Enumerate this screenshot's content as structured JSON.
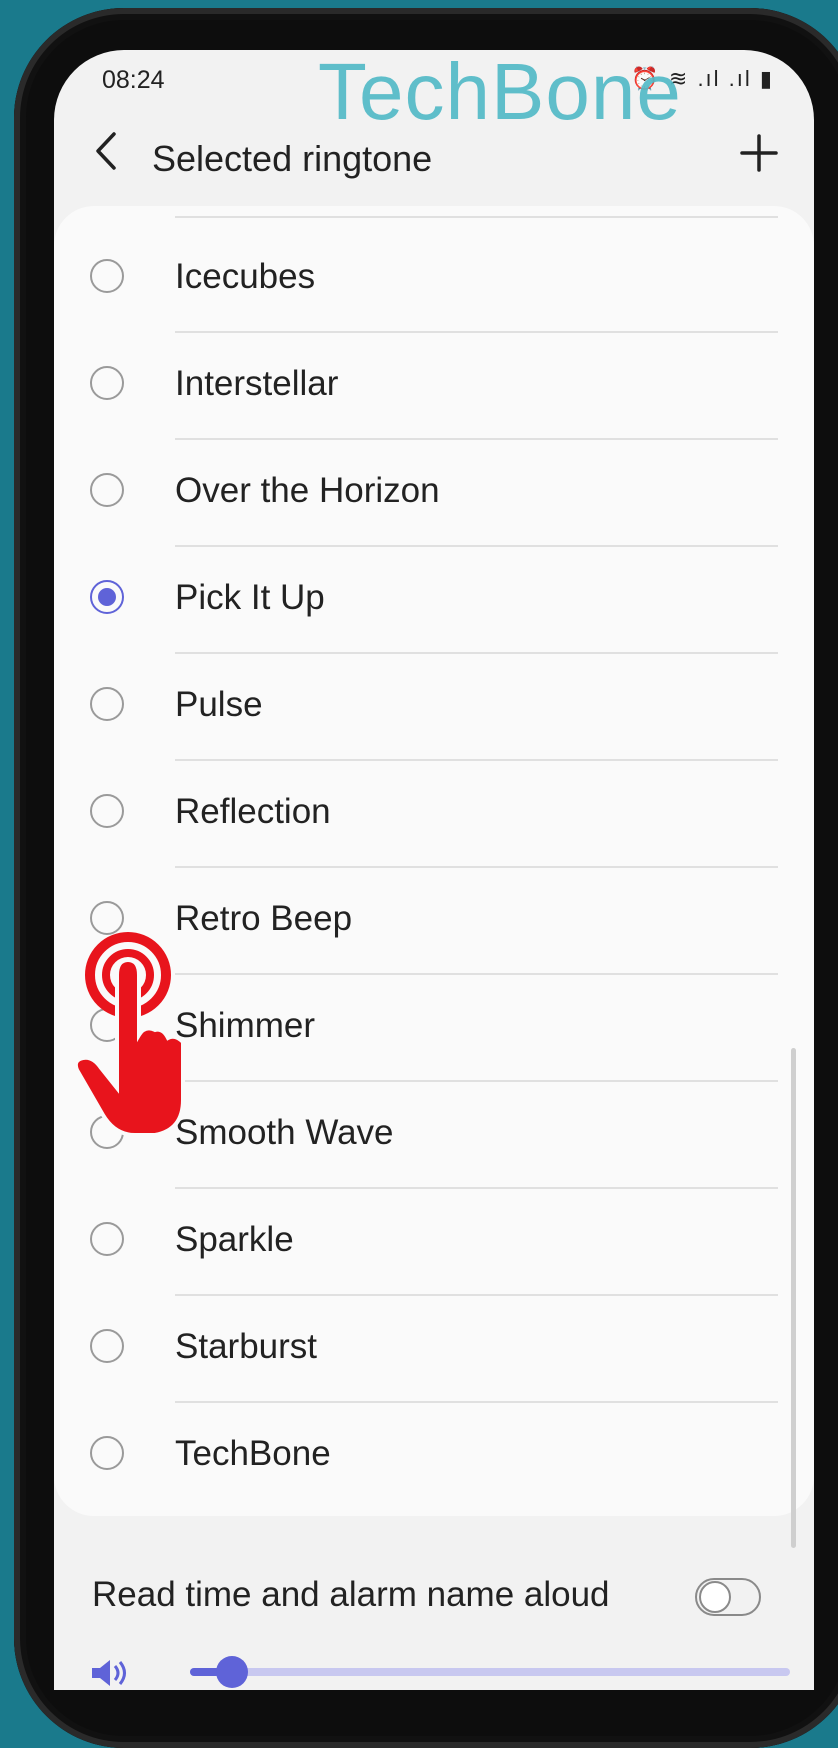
{
  "status": {
    "time": "08:24",
    "icons": "⏰ ≋ .ıl .ıl ▮"
  },
  "watermark": "TechBone",
  "header": {
    "title": "Selected ringtone"
  },
  "ringtones": [
    {
      "label": "Icecubes",
      "selected": false
    },
    {
      "label": "Interstellar",
      "selected": false
    },
    {
      "label": "Over the Horizon",
      "selected": false
    },
    {
      "label": "Pick It Up",
      "selected": true
    },
    {
      "label": "Pulse",
      "selected": false
    },
    {
      "label": "Reflection",
      "selected": false
    },
    {
      "label": "Retro Beep",
      "selected": false
    },
    {
      "label": "Shimmer",
      "selected": false
    },
    {
      "label": "Smooth Wave",
      "selected": false
    },
    {
      "label": "Sparkle",
      "selected": false
    },
    {
      "label": "Starburst",
      "selected": false
    },
    {
      "label": "TechBone",
      "selected": false
    }
  ],
  "read_aloud": {
    "label": "Read time and alarm name aloud",
    "on": false
  },
  "volume": {
    "level": 0.05
  },
  "colors": {
    "accent": "#5f63d8",
    "background": "#1a7a8c",
    "tap_hand": "#e8141c"
  },
  "icons": [
    "back-arrow-icon",
    "add-icon",
    "volume-icon",
    "tap-hand-icon"
  ]
}
